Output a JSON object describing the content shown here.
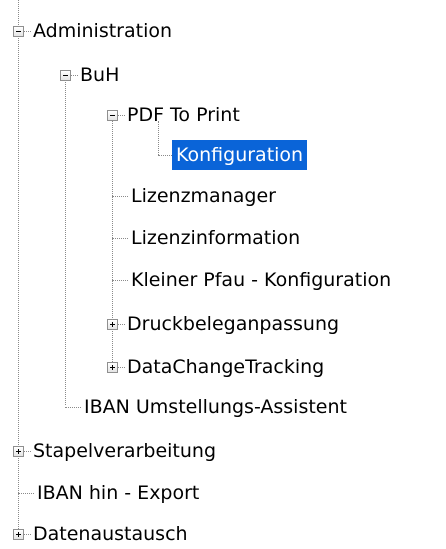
{
  "tree": {
    "administration": "Administration",
    "buh": "BuH",
    "pdf_to_print": "PDF To Print",
    "konfiguration": "Konfiguration",
    "lizenzmanager": "Lizenzmanager",
    "lizenzinformation": "Lizenzinformation",
    "kleiner_pfau": "Kleiner Pfau - Konfiguration",
    "druckbeleganpassung": "Druckbeleganpassung",
    "datachangetracking": "DataChangeTracking",
    "iban_umstellung": "IBAN Umstellungs-Assistent",
    "stapelverarbeitung": "Stapelverarbeitung",
    "iban_export": "IBAN hin - Export",
    "datenaustausch": "Datenaustausch"
  },
  "icons": {
    "expanded": "minus-box-icon",
    "collapsed": "plus-box-icon"
  },
  "colors": {
    "selection_bg": "#0a64d8",
    "selection_text": "#ffffff"
  }
}
